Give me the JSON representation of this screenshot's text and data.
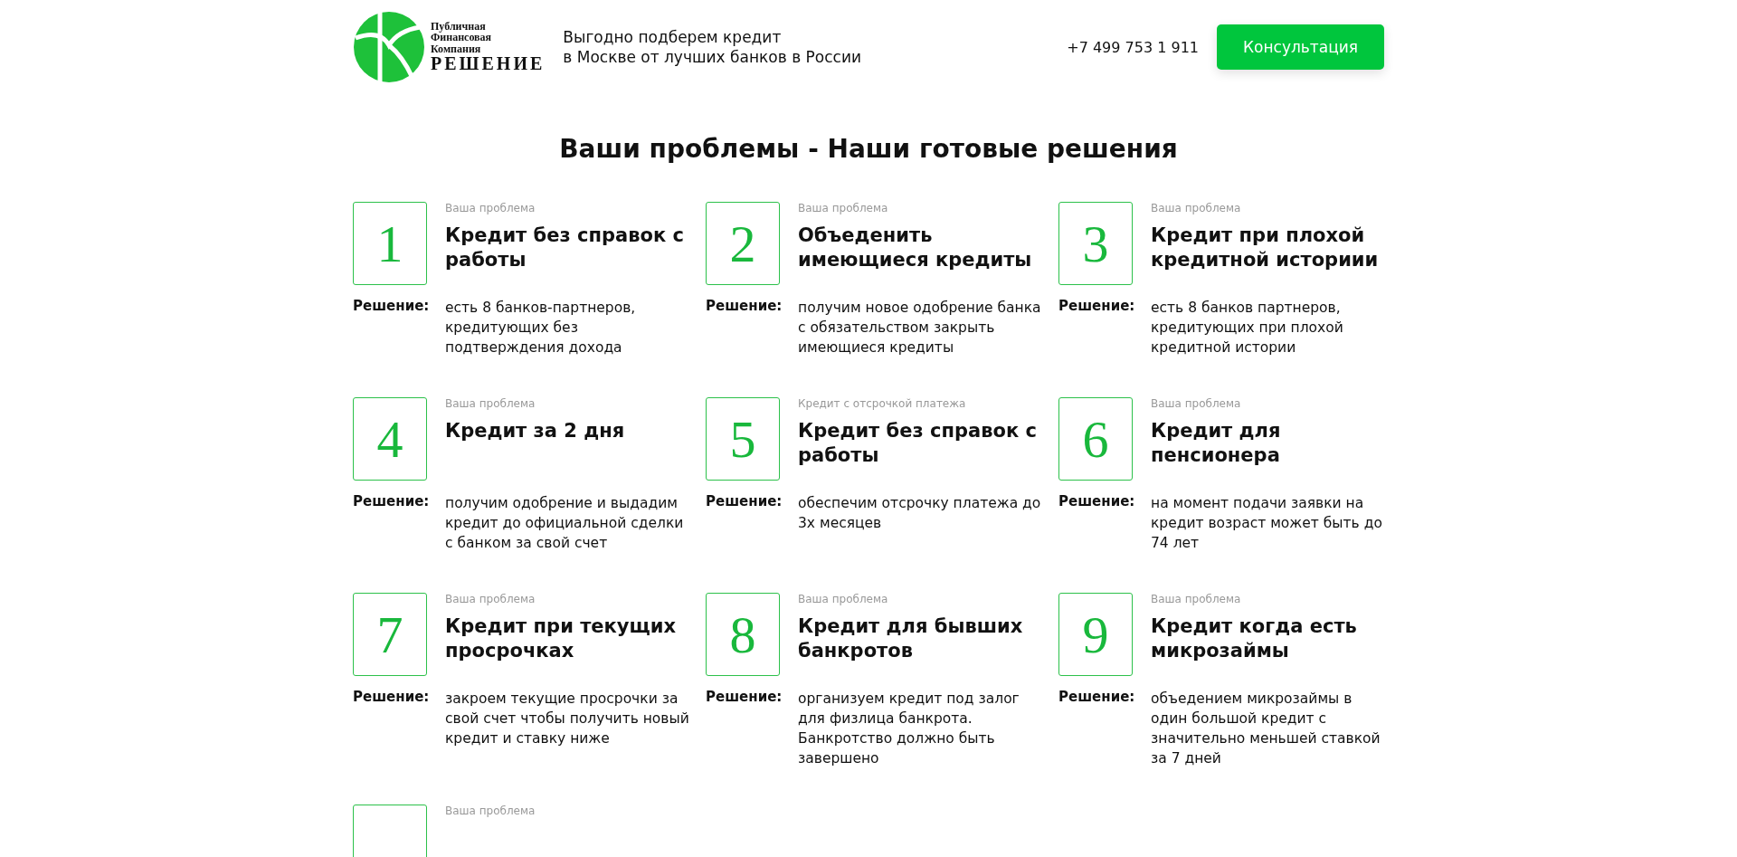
{
  "header": {
    "logo_lines": [
      "Публичная",
      "Финансовая",
      "Компания"
    ],
    "logo_name": "РЕШЕНИЕ",
    "tagline": [
      "Выгодно подберем кредит",
      "в Москве от лучших банков в России"
    ],
    "phone": "+7 499 753 1 911",
    "button": "Консультация"
  },
  "heading": "Ваши проблемы - Наши готовые решения",
  "cards": [
    {
      "number": "1",
      "label": "Ваша проблема",
      "title": "Кредит без справок с работы",
      "solution_label": "Решение:",
      "solution": "есть 8 банков-партнеров, кредитующих без подтверждения дохода"
    },
    {
      "number": "2",
      "label": "Ваша проблема",
      "title": "Объеденить имеющиеся кредиты",
      "solution_label": "Решение:",
      "solution": "получим новое одобрение банка с обязательством закрыть имеющиеся кредиты"
    },
    {
      "number": "3",
      "label": "Ваша проблема",
      "title": "Кредит при плохой кредитной историии",
      "solution_label": "Решение:",
      "solution": "есть 8 банков партнеров, кредитующих при плохой кредитной истории"
    },
    {
      "number": "4",
      "label": "Ваша проблема",
      "title": "Кредит за 2 дня",
      "solution_label": "Решение:",
      "solution": "получим одобрение и выдадим кредит до официальной сделки с банком за свой счет"
    },
    {
      "number": "5",
      "label": "Кредит с отсрочкой платежа",
      "title": "Кредит без справок с работы",
      "solution_label": "Решение:",
      "solution": "обеспечим отсрочку платежа до 3х месяцев"
    },
    {
      "number": "6",
      "label": "Ваша проблема",
      "title": "Кредит для пенсионера",
      "solution_label": "Решение:",
      "solution": "на момент подачи заявки на кредит возраст может быть до 74 лет"
    },
    {
      "number": "7",
      "label": "Ваша проблема",
      "title": "Кредит при текущих просрочках",
      "solution_label": "Решение:",
      "solution": "закроем текущие просрочки за свой счет чтобы получить новый кредит и ставку ниже"
    },
    {
      "number": "8",
      "label": "Ваша проблема",
      "title": "Кредит для бывших банкротов",
      "solution_label": "Решение:",
      "solution": "организуем кредит под залог для физлица банкрота. Банкротство должно быть завершено"
    },
    {
      "number": "9",
      "label": "Ваша проблема",
      "title": "Кредит когда есть микрозаймы",
      "solution_label": "Решение:",
      "solution": "объедением микрозаймы в один большой кредит с значительно меньшей ставкой за 7 дней"
    },
    {
      "label": "Ваша проблема"
    }
  ]
}
